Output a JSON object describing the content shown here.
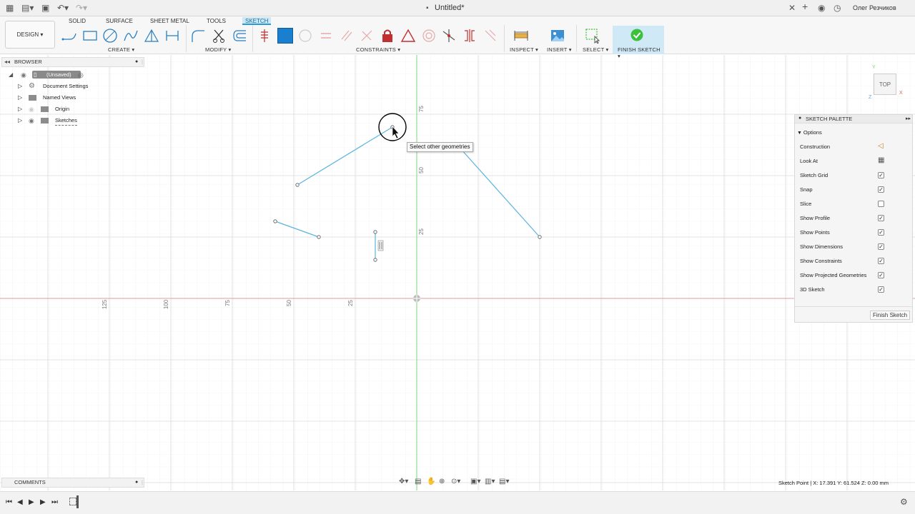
{
  "window": {
    "title": "Untitled*",
    "user": "Олег Резчиков"
  },
  "tabs": [
    "SOLID",
    "SURFACE",
    "SHEET METAL",
    "TOOLS",
    "SKETCH"
  ],
  "active_tab": "SKETCH",
  "workspace_button": "DESIGN ▾",
  "groups": {
    "create": "CREATE ▾",
    "modify": "MODIFY ▾",
    "constraints": "CONSTRAINTS ▾",
    "inspect": "INSPECT ▾",
    "insert": "INSERT ▾",
    "select": "SELECT ▾",
    "finish": "FINISH SKETCH ▾"
  },
  "browser": {
    "title": "BROWSER",
    "items": [
      {
        "label": "(Unsaved)"
      },
      {
        "label": "Document Settings"
      },
      {
        "label": "Named Views"
      },
      {
        "label": "Origin"
      },
      {
        "label": "Sketches"
      }
    ]
  },
  "comments": {
    "title": "COMMENTS"
  },
  "axis_labels": {
    "vertical": [
      "75",
      "50",
      "25"
    ],
    "horizontal": [
      "125",
      "100",
      "75",
      "50",
      "25"
    ]
  },
  "tooltip": "Select other geometries",
  "palette": {
    "title": "SKETCH PALETTE",
    "section": "Options",
    "options": [
      {
        "label": "Construction",
        "type": "icon",
        "icon": "construction-icon"
      },
      {
        "label": "Look At",
        "type": "icon",
        "icon": "look-at-icon"
      },
      {
        "label": "Sketch Grid",
        "type": "checkbox",
        "checked": true
      },
      {
        "label": "Snap",
        "type": "checkbox",
        "checked": true
      },
      {
        "label": "Slice",
        "type": "checkbox",
        "checked": false
      },
      {
        "label": "Show Profile",
        "type": "checkbox",
        "checked": true
      },
      {
        "label": "Show Points",
        "type": "checkbox",
        "checked": true
      },
      {
        "label": "Show Dimensions",
        "type": "checkbox",
        "checked": true
      },
      {
        "label": "Show Constraints",
        "type": "checkbox",
        "checked": true
      },
      {
        "label": "Show Projected Geometries",
        "type": "checkbox",
        "checked": true
      },
      {
        "label": "3D Sketch",
        "type": "checkbox",
        "checked": true
      }
    ],
    "finish_button": "Finish Sketch"
  },
  "viewcube": {
    "face": "TOP",
    "axis_x": "X",
    "axis_y": "Y",
    "axis_z": "Z"
  },
  "status": "Sketch Point | X: 17.391 Y: 61.524 Z: 0.00 mm",
  "colors": {
    "sketch_line": "#5ab4e0",
    "x_axis": "#d8a0a0",
    "y_axis": "#7fd37f",
    "accent": "#2a9ad6",
    "finish_green": "#3cc13c"
  }
}
